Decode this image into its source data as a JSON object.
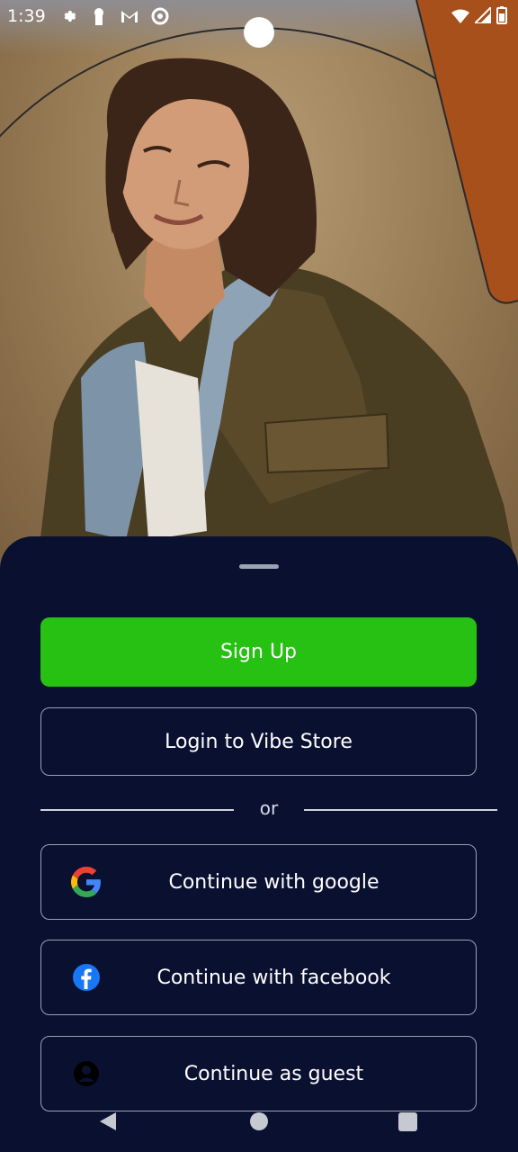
{
  "status_bar": {
    "time": "1:39",
    "icons": [
      "settings-icon",
      "keyhole-icon",
      "gmail-icon",
      "sync-icon"
    ],
    "right_icons": [
      "wifi-icon",
      "signal-icon",
      "battery-icon"
    ]
  },
  "colors": {
    "sheet_background": "#0a1130",
    "signup_green": "#26c112",
    "accent_orange": "#a8501c"
  },
  "auth": {
    "signup_label": "Sign Up",
    "login_label": "Login to Vibe Store",
    "or_label": "or",
    "google_label": "Continue with google",
    "facebook_label": "Continue with facebook",
    "guest_label": "Continue as guest"
  },
  "nav": {
    "items": [
      "back-icon",
      "home-icon",
      "recents-icon"
    ]
  }
}
